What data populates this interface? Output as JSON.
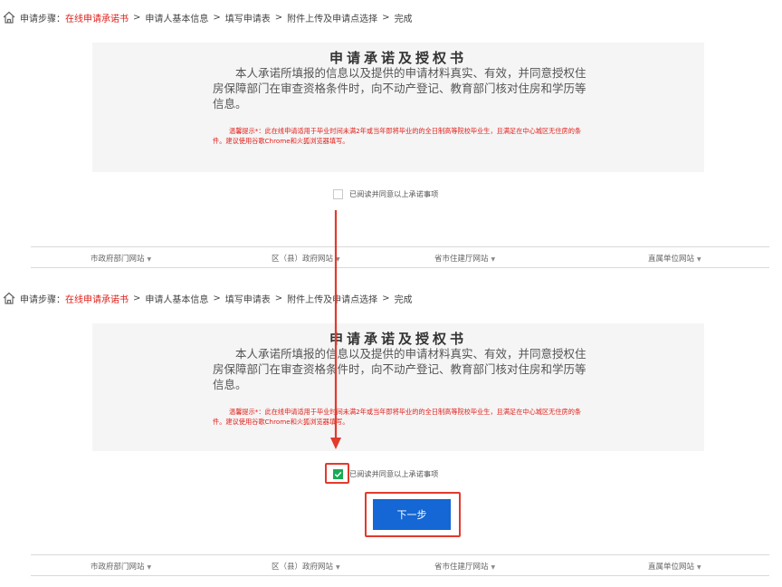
{
  "breadcrumb": {
    "label": "申请步骤：",
    "current": "在线申请承诺书",
    "steps": [
      "申请人基本信息",
      "填写申请表",
      "附件上传及申请点选择",
      "完成"
    ],
    "separator": ">"
  },
  "commitment": {
    "title": "申请承诺及授权书",
    "body": "本人承诺所填报的信息以及提供的申请材料真实、有效，并同意授权住房保障部门在审查资格条件时，向不动产登记、教育部门核对住房和学历等信息。",
    "tip": "温馨提示*：此在线申请适用于毕业时间未满2年或当年即将毕业的的全日制高等院校毕业生，且满足在中心城区无住房的条件。建议使用谷歌Chrome和火狐浏览器填写。"
  },
  "agreement": {
    "label": "已阅读并同意以上承诺事项",
    "checked_before": false,
    "checked_after": true
  },
  "next_button": {
    "label": "下一步"
  },
  "footer_links": [
    "市政府部门网站",
    "区（县）政府网站",
    "省市住建厅网站",
    "直属单位网站"
  ],
  "colors": {
    "accent_red": "#e0201b",
    "button_blue": "#1467d4",
    "check_green": "#1aaa55",
    "annotation_red": "#e23a2c"
  }
}
